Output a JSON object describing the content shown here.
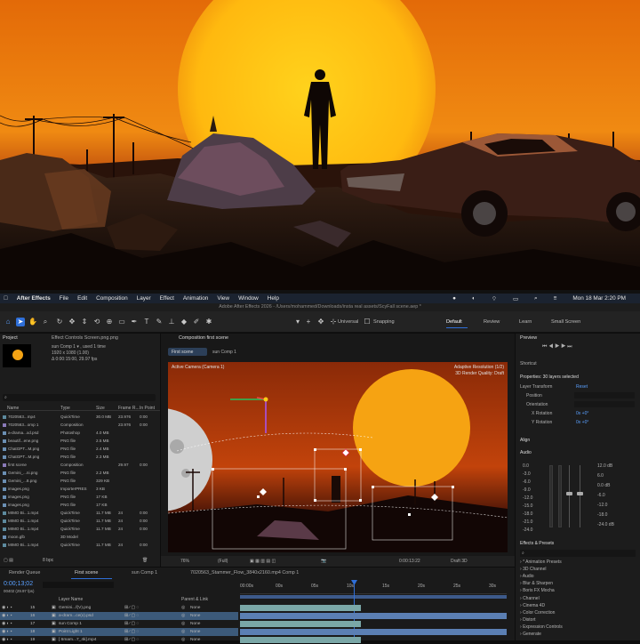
{
  "menubar": {
    "app": "After Effects",
    "items": [
      "File",
      "Edit",
      "Composition",
      "Layer",
      "Effect",
      "Animation",
      "View",
      "Window",
      "Help"
    ],
    "datetime": "Mon 18 Mar 2:20 PM"
  },
  "titlebar": {
    "text": "Adobe After Effects 2026 - /Users/mohammed/Downloads/insta real assets/ScyFall scene.aep *"
  },
  "toolbar": {
    "universal": "Universal",
    "snapping": "Snapping",
    "workspaces": [
      "Default",
      "Review",
      "Learn",
      "Small Screen"
    ]
  },
  "project": {
    "tab": "Project",
    "effect_controls_tab": "Effect Controls Screen.png.png",
    "selected_name": "sun Comp 1 ▾ , used 1 time",
    "selected_info1": "1920 x 1080 (1.00)",
    "selected_info2": "Δ 0:00:15:00, 29.97 fps",
    "search_placeholder": "⌕",
    "columns": [
      "Name",
      "Type",
      "Size",
      "Frame R...",
      "In Point"
    ],
    "rows": [
      {
        "name": "7020563...mp4",
        "type": "QuickTime",
        "size": "30.0 MB",
        "fr": "23.976",
        "in": "0:00"
      },
      {
        "name": "7020563...omp 1",
        "type": "Composition",
        "size": "",
        "fr": "23.976",
        "in": "0:00"
      },
      {
        "name": "a-drama...xd.psd",
        "type": "Photoshop",
        "size": "4.0 MB",
        "fr": "",
        "in": ""
      },
      {
        "name": "beautif...ene.png",
        "type": "PNG file",
        "size": "2.5 MB",
        "fr": "",
        "in": ""
      },
      {
        "name": "ChatGPT...M.png",
        "type": "PNG file",
        "size": "2.4 MB",
        "fr": "",
        "in": ""
      },
      {
        "name": "ChatGPT...M.png",
        "type": "PNG file",
        "size": "2.3 MB",
        "fr": "",
        "in": ""
      },
      {
        "name": "first scene",
        "type": "Composition",
        "size": "",
        "fr": "29.97",
        "in": "0:00"
      },
      {
        "name": "Gemini_...ni.png",
        "type": "PNG file",
        "size": "2.2 MB",
        "fr": "",
        "in": ""
      },
      {
        "name": "Gemini_...8.png",
        "type": "PNG file",
        "size": "329 KB",
        "fr": "",
        "in": ""
      },
      {
        "name": "images.png",
        "type": "ImporterPRES",
        "size": "3 KB",
        "fr": "",
        "in": ""
      },
      {
        "name": "images.png",
        "type": "PNG file",
        "size": "17 KB",
        "fr": "",
        "in": ""
      },
      {
        "name": "images.png",
        "type": "PNG file",
        "size": "17 KB",
        "fr": "",
        "in": ""
      },
      {
        "name": "MIMO Bi...1.mp4",
        "type": "QuickTime",
        "size": "11.7 MB",
        "fr": "24",
        "in": "0:00"
      },
      {
        "name": "MIMO Bi...1.mp4",
        "type": "QuickTime",
        "size": "11.7 MB",
        "fr": "24",
        "in": "0:00"
      },
      {
        "name": "MIMO Bi...1.mp4",
        "type": "QuickTime",
        "size": "11.7 MB",
        "fr": "24",
        "in": "0:00"
      },
      {
        "name": "moon.glb",
        "type": "3D Model",
        "size": "",
        "fr": "",
        "in": ""
      },
      {
        "name": "MIMO Bi...1.mp4",
        "type": "QuickTime",
        "size": "11.7 MB",
        "fr": "24",
        "in": "0:00"
      }
    ],
    "bpc": "8 bpc"
  },
  "composition": {
    "tab": "Composition first scene",
    "flow_tabs": [
      "First scene",
      "sun Comp 1"
    ],
    "camera_label": "Active Camera (Camera 1)",
    "renderer": "Adaptive Resolution (1/2)",
    "quality": "3D Render Quality: Draft",
    "zoom": "76%",
    "resolution": "(Full)",
    "timecode": "0:00:13:22",
    "draft": "Draft 3D"
  },
  "properties": {
    "preview_tab": "Preview",
    "shortcut": "Shortcut",
    "title": "Properties: 30 layers selected",
    "layer_transform": "Layer Transform",
    "reset": "Reset",
    "position": "Position",
    "orientation": "Orientation",
    "x_rotation": "X Rotation",
    "y_rotation": "Y Rotation",
    "x_rot_val": "0x +0°",
    "y_rot_val": "0x +0°",
    "align": "Align",
    "audio": "Audio",
    "audio_left": [
      "0.0",
      "-3.0",
      "-6.0",
      "-9.0",
      "-12.0",
      "-15.0",
      "-18.0",
      "-21.0",
      "-24.0"
    ],
    "audio_right": [
      "12.0 dB",
      "6.0",
      "0.0 dB",
      "-6.0",
      "-12.0",
      "-18.0",
      "-24.0 dB"
    ],
    "effects_tab": "Effects & Presets",
    "effects_search": "⌕",
    "effects": [
      "* Animation Presets",
      "3D Channel",
      "Audio",
      "Blur & Sharpen",
      "Boris FX Mocha",
      "Channel",
      "Cinema 4D",
      "Color Correction",
      "Distort",
      "Expression Controls",
      "Generate"
    ]
  },
  "timeline": {
    "render_queue": "Render Queue",
    "tab1": "First scene",
    "tab2": "sun Comp 1",
    "tab3": "7020563_Stammer_Flow_3840x2160.mp4 Comp 1",
    "timecode": "0:00;13;02",
    "frames": "00402 (29.97 fps)",
    "col_layer": "Layer Name",
    "col_parent": "Parent & Link",
    "ruler": [
      "00:00s",
      "00s",
      "05s",
      "10s",
      "15s",
      "20s",
      "25s",
      "30s"
    ],
    "rows": [
      {
        "num": "15",
        "name": "Gemini...f(V).png",
        "parent": "None"
      },
      {
        "num": "16",
        "name": "a-dram...ce(x).psd",
        "parent": "None"
      },
      {
        "num": "17",
        "name": "sun Comp 1",
        "parent": "None"
      },
      {
        "num": "18",
        "name": "Point Light 1",
        "parent": "None"
      },
      {
        "num": "19",
        "name": "[ 6mam...7_4k].mp4",
        "parent": "None"
      }
    ]
  },
  "colors": {
    "accent": "#2f6fd8",
    "layer_blue": "#5b7fb3",
    "layer_teal": "#7aa7a7",
    "selection": "#3c5a7a"
  }
}
